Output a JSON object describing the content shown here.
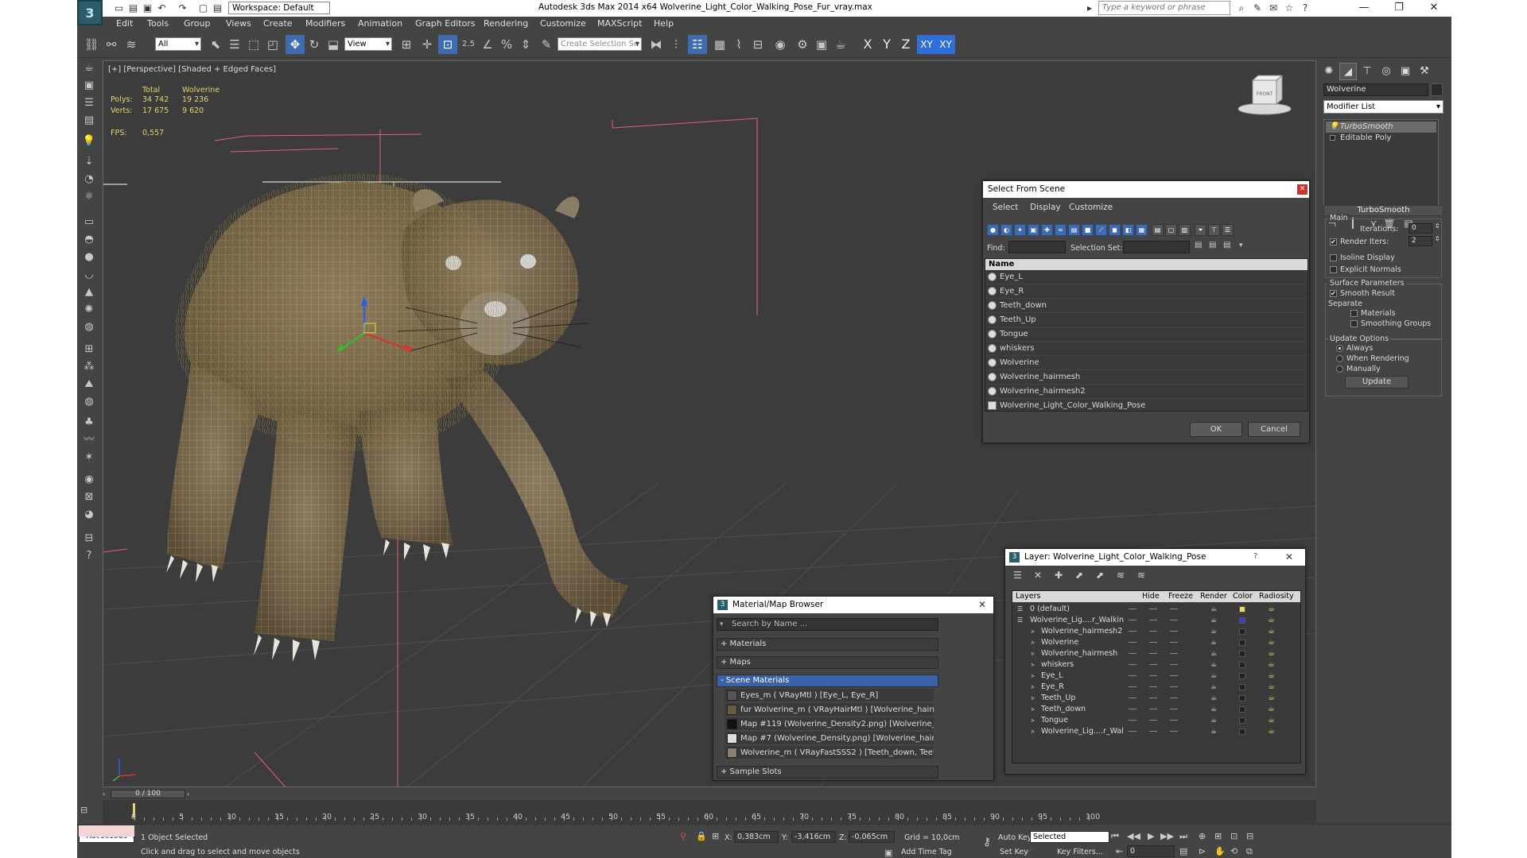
{
  "title_bar": {
    "workspace": "Workspace: Default",
    "app_title": "Autodesk 3ds Max  2014 x64      Wolverine_Light_Color_Walking_Pose_Fur_vray.max",
    "search_placeholder": "Type a keyword or phrase",
    "minimize": "—",
    "maximize": "❐",
    "close": "✕"
  },
  "menu": [
    "Edit",
    "Tools",
    "Group",
    "Views",
    "Create",
    "Modifiers",
    "Animation",
    "Graph Editors",
    "Rendering",
    "Customize",
    "MAXScript",
    "Help"
  ],
  "toolbar": {
    "selection_filter": "All",
    "ref_coord": "View",
    "named_selection": "Create Selection Se",
    "snap_value": "2.5",
    "axes": [
      "X",
      "Y",
      "Z",
      "XY",
      "XY"
    ]
  },
  "viewport": {
    "label": "[+] [Perspective] [Shaded + Edged Faces]",
    "stats": {
      "col_total": "Total",
      "col_object": "Wolverine",
      "polys_label": "Polys:",
      "polys_total": "34 742",
      "polys_obj": "19 236",
      "verts_label": "Verts:",
      "verts_total": "17 675",
      "verts_obj": "9 620",
      "fps_label": "FPS:",
      "fps_value": "0,557"
    },
    "viewcube_label": "FRONT"
  },
  "command_panel": {
    "object_name": "Wolverine",
    "modifier_list": "Modifier List",
    "stack": [
      "TurboSmooth",
      "Editable Poly"
    ],
    "rollout_title": "TurboSmooth",
    "main_group": "Main",
    "iterations_label": "Iterations:",
    "iterations_value": "0",
    "render_iters_label": "Render Iters:",
    "render_iters_value": "2",
    "isoline": "Isoline Display",
    "explicit_normals": "Explicit Normals",
    "surface_group": "Surface Parameters",
    "smooth_result": "Smooth Result",
    "separate": "Separate",
    "materials": "Materials",
    "smoothing_groups": "Smoothing Groups",
    "update_group": "Update Options",
    "always": "Always",
    "when_rendering": "When Rendering",
    "manually": "Manually",
    "update_button": "Update"
  },
  "select_dialog": {
    "title": "Select From Scene",
    "menu": [
      "Select",
      "Display",
      "Customize"
    ],
    "find_label": "Find:",
    "selection_set_label": "Selection Set:",
    "column": "Name",
    "items": [
      "Eye_L",
      "Eye_R",
      "Teeth_down",
      "Teeth_Up",
      "Tongue",
      "whiskers",
      "Wolverine",
      "Wolverine_hairmesh",
      "Wolverine_hairmesh2",
      "Wolverine_Light_Color_Walking_Pose"
    ],
    "ok": "OK",
    "cancel": "Cancel"
  },
  "material_browser": {
    "title": "Material/Map Browser",
    "search_placeholder": "Search by Name ...",
    "categories": [
      "+ Materials",
      "+ Maps",
      "- Scene Materials"
    ],
    "items": [
      "Eyes_m  ( VRayMtl )  [Eye_L, Eye_R]",
      "fur Wolverine_m  ( VRayHairMtl )  [Wolverine_hairmesh, Wolveri...",
      "Map #119 (Wolverine_Density2.png)  [Wolverine_hairmesh2]",
      "Map #7 (Wolverine_Density.png)  [Wolverine_hairmesh]",
      "Wolverine_m  ( VRayFastSSS2 )  [Teeth_down, Teeth_Up, Tong..."
    ],
    "sample_slots": "+ Sample Slots"
  },
  "layer_dialog": {
    "title": "Layer: Wolverine_Light_Color_Walking_Pose",
    "help": "?",
    "columns": [
      "Layers",
      "Hide",
      "Freeze",
      "Render",
      "Color",
      "Radiosity"
    ],
    "rows": [
      {
        "name": "0 (default)",
        "indent": 0,
        "color": "#e8e060"
      },
      {
        "name": "Wolverine_Lig....r_Walkin",
        "indent": 0,
        "color": "#3a3ad0"
      },
      {
        "name": "Wolverine_hairmesh2",
        "indent": 1,
        "color": "#222222"
      },
      {
        "name": "Wolverine",
        "indent": 1,
        "color": "#222222"
      },
      {
        "name": "Wolverine_hairmesh",
        "indent": 1,
        "color": "#222222"
      },
      {
        "name": "whiskers",
        "indent": 1,
        "color": "#222222"
      },
      {
        "name": "Eye_L",
        "indent": 1,
        "color": "#222222"
      },
      {
        "name": "Eye_R",
        "indent": 1,
        "color": "#222222"
      },
      {
        "name": "Teeth_Up",
        "indent": 1,
        "color": "#222222"
      },
      {
        "name": "Teeth_down",
        "indent": 1,
        "color": "#222222"
      },
      {
        "name": "Tongue",
        "indent": 1,
        "color": "#222222"
      },
      {
        "name": "Wolverine_Lig....r_Wal",
        "indent": 1,
        "color": "#222222"
      }
    ]
  },
  "timeline": {
    "frame": "0 / 100",
    "ticks": [
      "0",
      "5",
      "10",
      "15",
      "20",
      "25",
      "30",
      "35",
      "40",
      "45",
      "50",
      "55",
      "60",
      "65",
      "70",
      "75",
      "80",
      "85",
      "90",
      "95",
      "100"
    ]
  },
  "status": {
    "maxscript": "\"Malicious s",
    "selected": "1 Object Selected",
    "prompt": "Click and drag to select and move objects",
    "x_label": "X:",
    "x_value": "0,383cm",
    "y_label": "Y:",
    "y_value": "-3,416cm",
    "z_label": "Z:",
    "z_value": "-0,065cm",
    "grid": "Grid = 10,0cm",
    "add_time_tag": "Add Time Tag",
    "auto_key": "Auto Key",
    "set_key": "Set Key",
    "key_mode": "Selected",
    "key_filters": "Key Filters...",
    "frame_field": "0"
  }
}
